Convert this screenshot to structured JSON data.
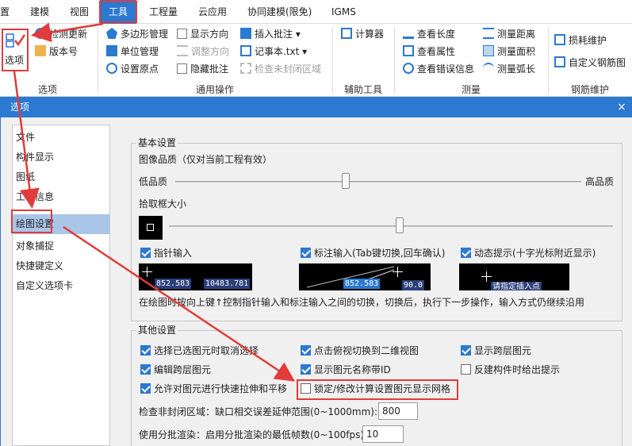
{
  "menu": {
    "items": [
      {
        "label": "置"
      },
      {
        "label": "建模"
      },
      {
        "label": "视图"
      },
      {
        "label": "工具"
      },
      {
        "label": "工程量"
      },
      {
        "label": "云应用"
      },
      {
        "label": "协同建模(限免)"
      },
      {
        "label": "IGMS"
      }
    ]
  },
  "ribbon": {
    "options_label": "选项",
    "check_update": "检测更新",
    "version": "版本号",
    "polygon_manage": "多边形管理",
    "unit_manage": "单位管理",
    "set_origin": "设置原点",
    "show_direction": "显示方向",
    "adjust_direction": "调整方向",
    "hide_annotation": "隐藏批注",
    "insert_annotation": "插入批注",
    "notepad": "记事本.txt",
    "check_unclosed": "检查未封闭区域",
    "calculator": "计算器",
    "view_length": "查看长度",
    "view_property": "查看属性",
    "view_error": "查看错误信息",
    "measure_distance": "测量距离",
    "measure_area": "测量面积",
    "measure_arc": "测量弧长",
    "loss_maint": "损耗维护",
    "custom_rebar": "自定义钢筋图",
    "groups": {
      "options": "选项",
      "general": "通用操作",
      "aux_tools": "辅助工具",
      "measure": "测量",
      "rebar": "钢筋维护"
    }
  },
  "dialog": {
    "title": "选项",
    "close": "×",
    "nav": [
      {
        "label": "文件"
      },
      {
        "label": "构件显示"
      },
      {
        "label": "图纸"
      },
      {
        "label": "工程信息"
      },
      {
        "label": "绘图设置"
      },
      {
        "label": "对象捕捉"
      },
      {
        "label": "快捷键定义"
      },
      {
        "label": "自定义选项卡"
      }
    ],
    "selected_nav": "绘图设置",
    "basic": {
      "title": "基本设置",
      "image_quality_label": "图像品质（仅对当前工程有效）",
      "low": "低品质",
      "high": "高品质",
      "image_quality_level": 0.42,
      "pick_box_label": "拾取框大小",
      "pick_box_level": 0.52,
      "pointer_input": "指针输入",
      "dim_input": "标注输入(Tab键切换,回车确认)",
      "dynamic_hint": "动态提示(十字光标附近显示)",
      "preview1_a": "852.583",
      "preview1_b": "10483.781",
      "preview2_a": "852.583",
      "preview2_b": "90.0",
      "preview3": "请指定插入点",
      "note": "在绘图时按向上键↑控制指针输入和标注输入之间的切换，切换后，执行下一步操作，输入方式仍继续沿用"
    },
    "other": {
      "title": "其他设置",
      "checks": [
        {
          "label": "选择已选图元时取消选择",
          "checked": true
        },
        {
          "label": "点击俯视切换到二维视图",
          "checked": true
        },
        {
          "label": "显示跨层图元",
          "checked": true
        },
        {
          "label": "编辑跨层图元",
          "checked": true
        },
        {
          "label": "显示图元名称带ID",
          "checked": true
        },
        {
          "label": "反建构件时给出提示",
          "checked": false
        },
        {
          "label": "允许对图元进行快速拉伸和平移",
          "checked": true
        },
        {
          "label": "锁定/修改计算设置图元显示网格",
          "checked": false
        }
      ],
      "unclosed_label": "检查非封闭区域：缺口相交误差延伸范围(0~1000mm):",
      "unclosed_value": "800",
      "batch_label": "使用分批渲染：启用分批渲染的最低帧数(0~100fps):",
      "batch_value": "10"
    }
  },
  "colors": {
    "accent": "#2b79d0",
    "highlight": "#e23b3b",
    "selected_row": "#a9c6e8"
  }
}
